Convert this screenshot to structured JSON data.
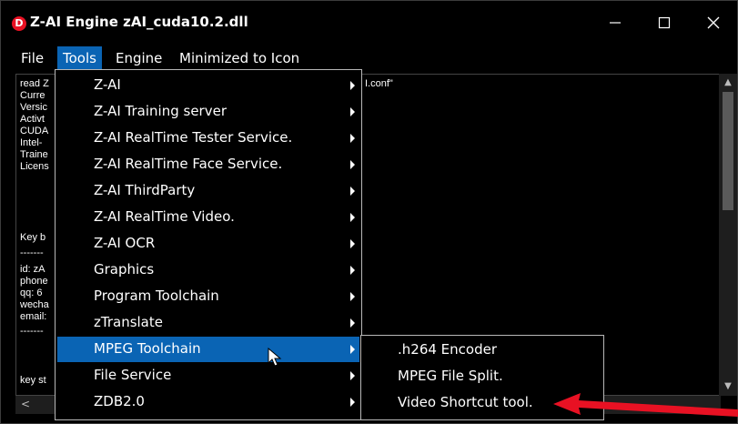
{
  "window": {
    "title": "Z-AI Engine zAI_cuda10.2.dll",
    "icon_letter": "D",
    "icon_name": "app-logo-icon",
    "controls": [
      "minimize-icon",
      "maximize-icon",
      "close-icon"
    ]
  },
  "menubar": {
    "items": [
      {
        "label": "File"
      },
      {
        "label": "Tools",
        "active": true
      },
      {
        "label": "Engine"
      },
      {
        "label": "Minimized to Icon"
      }
    ]
  },
  "log": {
    "lines": [
      "read Z",
      "Curre",
      "Versic",
      "Activt",
      "CUDA",
      "Intel-",
      "Traine",
      "Licens",
      "",
      "Key b",
      "-------",
      "id: zA",
      "phone",
      "qq: 6",
      "wecha",
      "email:",
      "-------",
      "",
      "key st"
    ],
    "conf_fragment": "I.conf\""
  },
  "tools_menu": {
    "items": [
      {
        "label": "Z-AI",
        "has_submenu": true
      },
      {
        "label": "Z-AI Training server",
        "has_submenu": true
      },
      {
        "label": "Z-AI RealTime Tester Service.",
        "has_submenu": true
      },
      {
        "label": "Z-AI RealTime Face Service.",
        "has_submenu": true
      },
      {
        "label": "Z-AI ThirdParty",
        "has_submenu": true
      },
      {
        "label": "Z-AI RealTime Video.",
        "has_submenu": true
      },
      {
        "label": "Z-AI OCR",
        "has_submenu": true
      },
      {
        "label": "Graphics",
        "has_submenu": true
      },
      {
        "label": "Program Toolchain",
        "has_submenu": true
      },
      {
        "label": "zTranslate",
        "has_submenu": true
      },
      {
        "label": "MPEG Toolchain",
        "has_submenu": true,
        "active": true
      },
      {
        "label": "File Service",
        "has_submenu": true
      },
      {
        "label": "ZDB2.0",
        "has_submenu": true
      }
    ]
  },
  "mpeg_submenu": {
    "items": [
      {
        "label": ".h264 Encoder"
      },
      {
        "label": "MPEG File Split."
      },
      {
        "label": "Video Shortcut tool."
      }
    ]
  },
  "colors": {
    "highlight": "#0a64b4",
    "background": "#000000",
    "annotation": "#e81123"
  }
}
